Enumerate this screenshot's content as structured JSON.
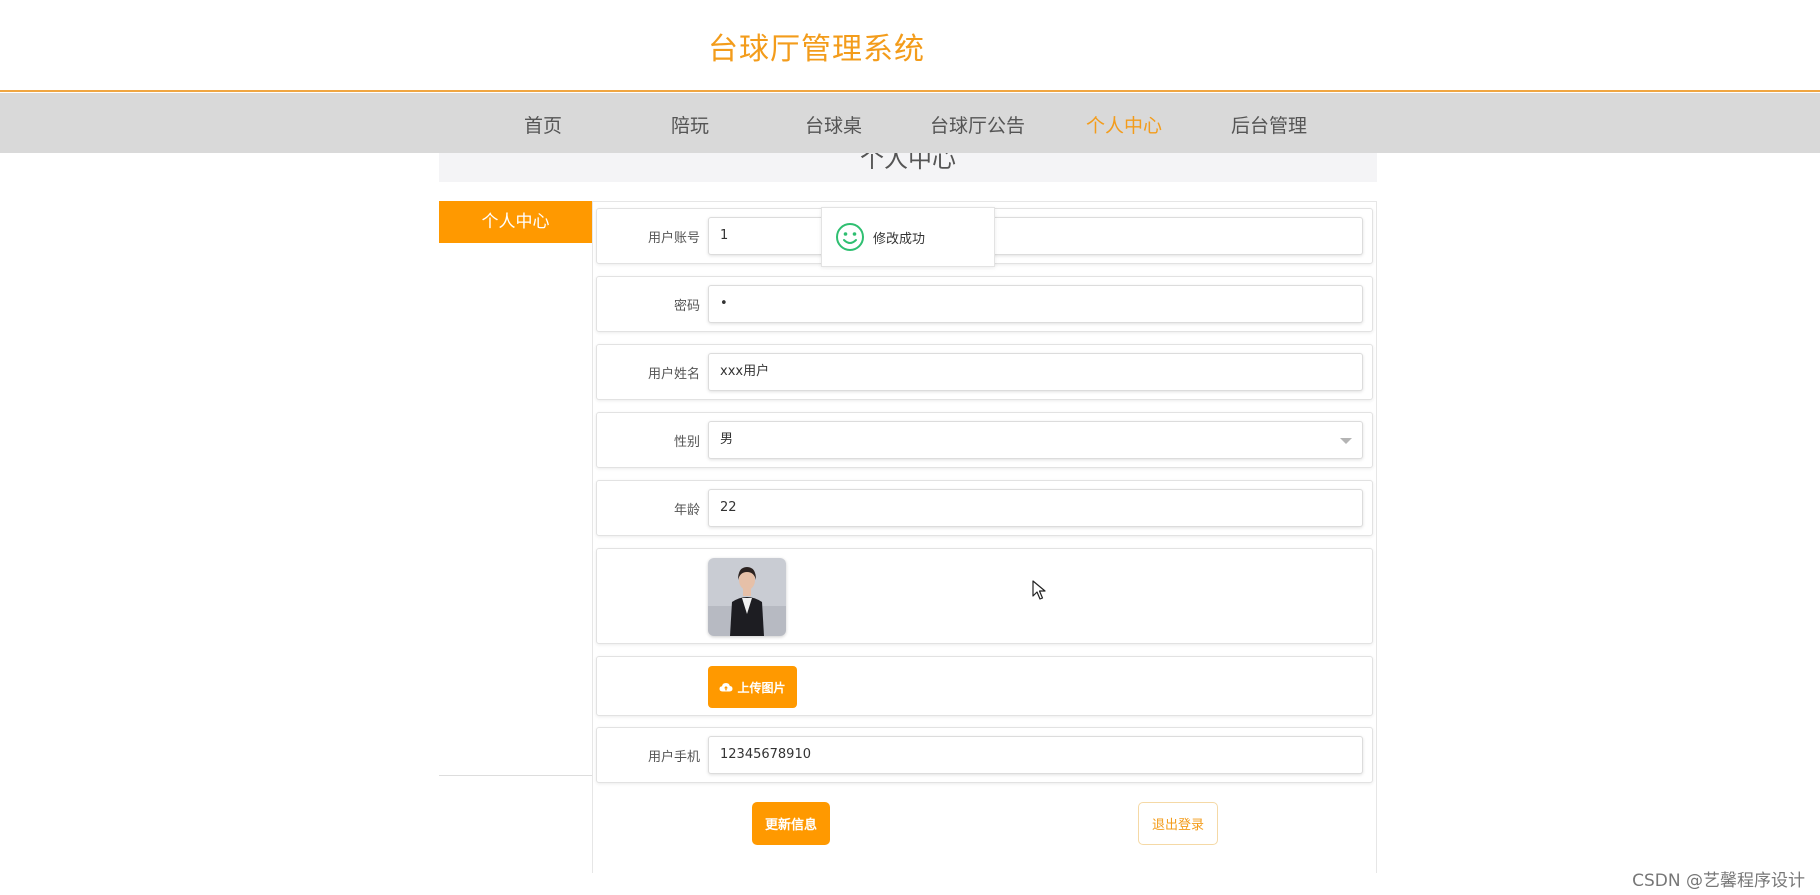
{
  "header": {
    "title": "台球厅管理系统"
  },
  "nav": {
    "items": [
      {
        "label": "首页"
      },
      {
        "label": "陪玩"
      },
      {
        "label": "台球桌"
      },
      {
        "label": "台球厅公告"
      },
      {
        "label": "个人中心"
      },
      {
        "label": "后台管理"
      }
    ],
    "active": "个人中心"
  },
  "banner": {
    "title": "个人中心"
  },
  "sidebar": {
    "active_item": "个人中心"
  },
  "form": {
    "account": {
      "label": "用户账号",
      "value": "1"
    },
    "password": {
      "label": "密码",
      "value": "•"
    },
    "name": {
      "label": "用户姓名",
      "value": "xxx用户"
    },
    "gender": {
      "label": "性别",
      "value": "男"
    },
    "age": {
      "label": "年龄",
      "value": "22"
    },
    "upload_label": "上传图片",
    "phone": {
      "label": "用户手机",
      "value": "12345678910"
    }
  },
  "actions": {
    "update": "更新信息",
    "logout": "退出登录"
  },
  "toast": {
    "message": "修改成功",
    "icon": "smile-icon"
  },
  "watermark": "CSDN @艺馨程序设计",
  "colors": {
    "accent": "#ff9900",
    "title": "#f39c1b",
    "nav_bg": "#d9d9d9",
    "toast_icon": "#2fbf71"
  }
}
